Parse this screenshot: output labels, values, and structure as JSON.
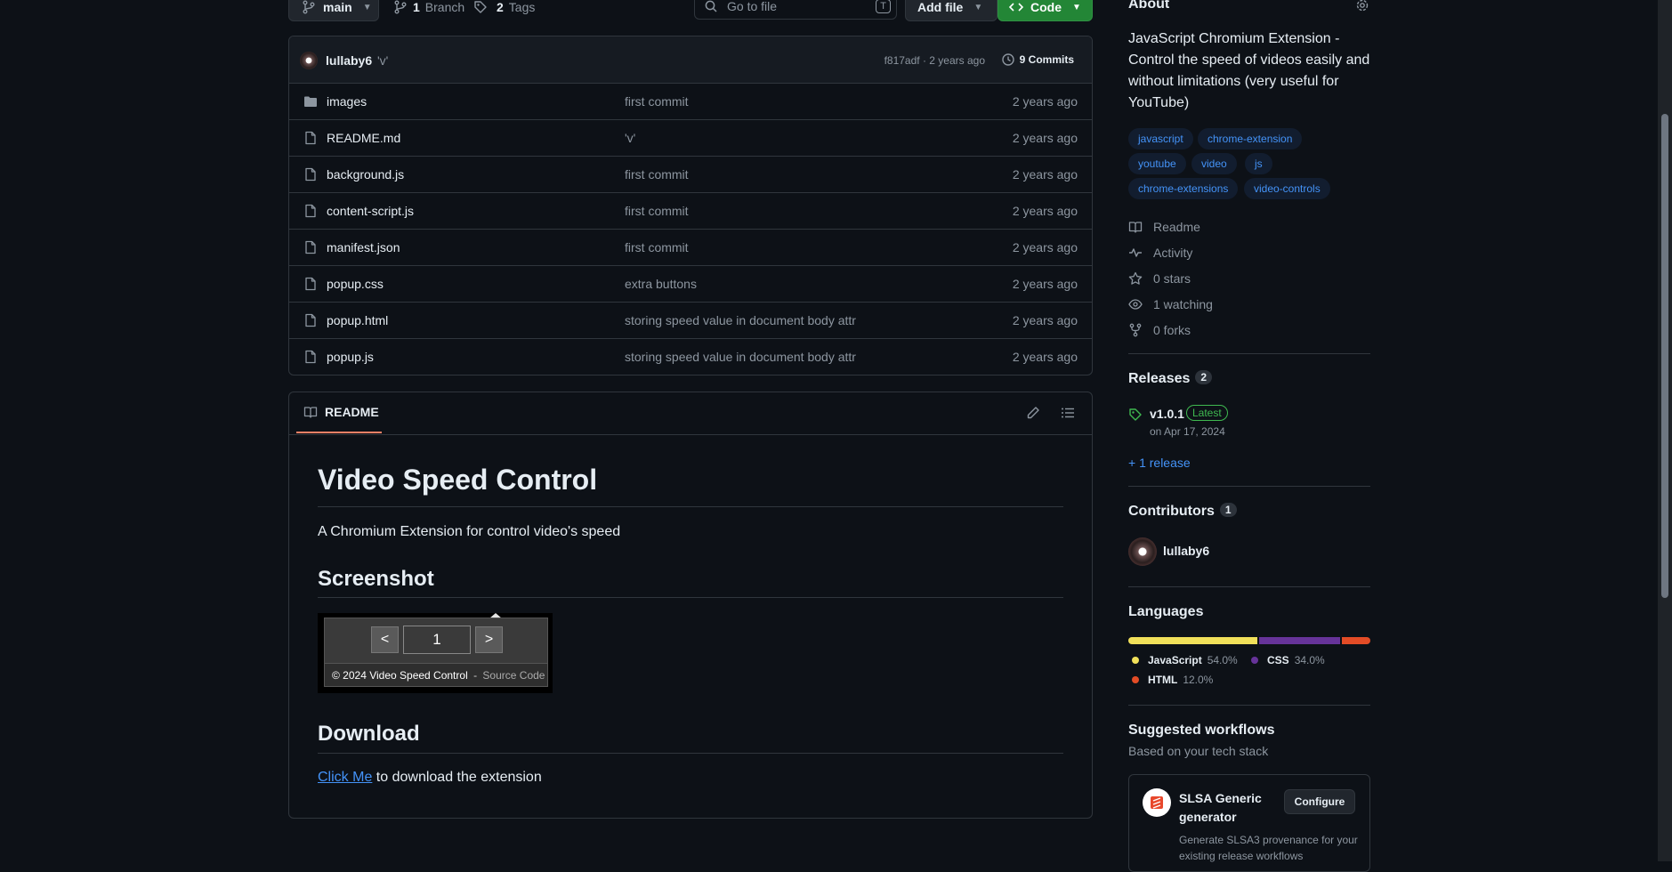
{
  "toolbar": {
    "branch_name": "main",
    "branch_count": "1",
    "branch_label": "Branch",
    "tag_count": "2",
    "tag_label": "Tags",
    "goto_placeholder": "Go to file",
    "goto_shortcut": "T",
    "add_file_label": "Add file",
    "code_label": "Code"
  },
  "commit": {
    "author": "lullaby6",
    "message": "'v'",
    "hash_age": "f817adf · 2 years ago",
    "count_label": "9 Commits"
  },
  "files": [
    {
      "name": "images",
      "type": "folder",
      "message": "first commit",
      "date": "2 years ago"
    },
    {
      "name": "README.md",
      "type": "file",
      "message": "'v'",
      "date": "2 years ago"
    },
    {
      "name": "background.js",
      "type": "file",
      "message": "first commit",
      "date": "2 years ago"
    },
    {
      "name": "content-script.js",
      "type": "file",
      "message": "first commit",
      "date": "2 years ago"
    },
    {
      "name": "manifest.json",
      "type": "file",
      "message": "first commit",
      "date": "2 years ago"
    },
    {
      "name": "popup.css",
      "type": "file",
      "message": "extra buttons",
      "date": "2 years ago"
    },
    {
      "name": "popup.html",
      "type": "file",
      "message": "storing speed value in document body attr",
      "date": "2 years ago"
    },
    {
      "name": "popup.js",
      "type": "file",
      "message": "storing speed value in document body attr",
      "date": "2 years ago"
    }
  ],
  "readme": {
    "tab_label": "README",
    "h1": "Video Speed Control",
    "intro": "A Chromium Extension for control video's speed",
    "h2_screenshot": "Screenshot",
    "popup": {
      "prev": "<",
      "value": "1",
      "next": ">",
      "footer": "© 2024 Video Speed Control",
      "separator": "-",
      "source": "Source Code"
    },
    "h2_download": "Download",
    "download_link": "Click Me",
    "download_text": "to download the extension"
  },
  "about": {
    "title": "About",
    "description": "JavaScript Chromium Extension - Control the speed of videos easily and without limitations (very useful for YouTube)",
    "topics": [
      "javascript",
      "chrome-extension",
      "youtube",
      "video",
      "js",
      "chrome-extensions",
      "video-controls"
    ],
    "readme": "Readme",
    "activity": "Activity",
    "stars": "0 stars",
    "watching": "1 watching",
    "forks": "0 forks"
  },
  "releases": {
    "title": "Releases",
    "count": "2",
    "version": "v1.0.1",
    "badge": "Latest",
    "date": "on Apr 17, 2024",
    "more": "+ 1 release"
  },
  "contributors": {
    "title": "Contributors",
    "count": "1",
    "name": "lullaby6"
  },
  "languages": {
    "title": "Languages",
    "items": [
      {
        "name": "JavaScript",
        "percent": "54.0%",
        "value": 54.0,
        "color": "#f1e05a"
      },
      {
        "name": "CSS",
        "percent": "34.0%",
        "value": 34.0,
        "color": "#663399"
      },
      {
        "name": "HTML",
        "percent": "12.0%",
        "value": 12.0,
        "color": "#e34c26"
      }
    ]
  },
  "workflows": {
    "title": "Suggested workflows",
    "subtitle": "Based on your tech stack",
    "card_title": "SLSA Generic generator",
    "card_desc": "Generate SLSA3 provenance for your existing release workflows",
    "configure": "Configure"
  },
  "colors": {
    "code_button": "#238636",
    "accent": "#4493f8",
    "latest": "#3fb950",
    "tab_underline": "#f78166"
  }
}
